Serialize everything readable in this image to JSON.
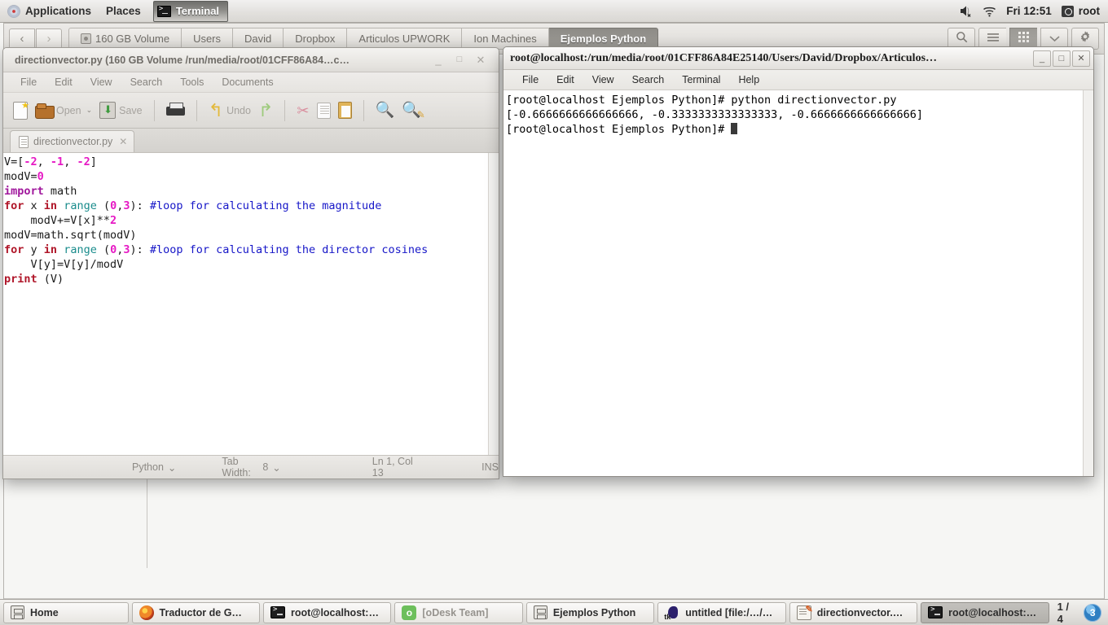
{
  "top_panel": {
    "applications_label": "Applications",
    "places_label": "Places",
    "active_task_label": "Terminal",
    "clock": "Fri 12:51",
    "user": "root",
    "icons": [
      "gnome-footprint-icon",
      "volume-muted-icon",
      "wifi-icon",
      "user-account-icon"
    ]
  },
  "file_manager": {
    "breadcrumbs": [
      {
        "label": "160 GB Volume",
        "active": false,
        "has_disk_icon": true
      },
      {
        "label": "Users",
        "active": false
      },
      {
        "label": "David",
        "active": false
      },
      {
        "label": "Dropbox",
        "active": false
      },
      {
        "label": "Articulos UPWORK",
        "active": false
      },
      {
        "label": "Ion Machines",
        "active": false
      },
      {
        "label": "Ejemplos Python",
        "active": true
      }
    ],
    "nav": {
      "back": "‹",
      "forward": "›"
    },
    "tools": [
      "search-icon",
      "list-view-icon",
      "grid-view-icon",
      "chevron-down-icon",
      "gear-icon"
    ]
  },
  "gedit": {
    "title": "directionvector.py (160 GB Volume /run/media/root/01CFF86A84…c…",
    "window_buttons": {
      "minimize": "_",
      "maximize": "□",
      "close": "✕"
    },
    "menus": [
      "File",
      "Edit",
      "View",
      "Search",
      "Tools",
      "Documents"
    ],
    "toolbar": {
      "open_label": "Open",
      "save_label": "Save",
      "undo_label": "Undo",
      "icons": [
        "new-document-icon",
        "open-folder-icon",
        "open-dropdown-caret-icon",
        "save-icon",
        "print-icon",
        "undo-icon",
        "redo-icon",
        "cut-icon",
        "copy-icon",
        "paste-icon",
        "find-icon",
        "find-replace-icon"
      ]
    },
    "tab": {
      "label": "directionvector.py",
      "close": "✕"
    },
    "code_lines": [
      "V=[-2, -1, -2]",
      "modV=0",
      "import math",
      "for x in range (0,3): #loop for calculating the magnitude",
      "    modV+=V[x]**2",
      "modV=math.sqrt(modV)",
      "for y in range (0,3): #loop for calculating the director cosines",
      "    V[y]=V[y]/modV",
      "print (V)"
    ],
    "statusbar": {
      "language": "Python",
      "language_caret": "⌄",
      "tab_width_label": "Tab Width:",
      "tab_width_value": "8",
      "tab_width_caret": "⌄",
      "position": "Ln 1, Col 13",
      "insert_mode": "INS"
    }
  },
  "terminal": {
    "title": "root@localhost:/run/media/root/01CFF86A84E25140/Users/David/Dropbox/Articulos…",
    "window_buttons": {
      "minimize": "_",
      "maximize": "□",
      "close": "✕"
    },
    "menus": [
      "File",
      "Edit",
      "View",
      "Search",
      "Terminal",
      "Help"
    ],
    "lines": [
      "[root@localhost Ejemplos Python]# python directionvector.py",
      "[-0.6666666666666666, -0.3333333333333333, -0.6666666666666666]",
      "[root@localhost Ejemplos Python]# "
    ]
  },
  "taskbar": {
    "buttons": [
      {
        "label": "Home",
        "icon": "file-manager-icon",
        "active": false,
        "dim": false
      },
      {
        "label": "Traductor de G…",
        "icon": "firefox-icon",
        "active": false,
        "dim": false
      },
      {
        "label": "root@localhost:…",
        "icon": "terminal-icon",
        "active": false,
        "dim": false
      },
      {
        "label": "[oDesk Team]",
        "icon": "odesk-icon",
        "active": false,
        "dim": true
      },
      {
        "label": "Ejemplos Python",
        "icon": "file-manager-icon",
        "active": false,
        "dim": false
      },
      {
        "label": "untitled [file:/…/…",
        "icon": "tk-icon",
        "active": false,
        "dim": false
      },
      {
        "label": "directionvector.…",
        "icon": "gedit-icon",
        "active": false,
        "dim": false
      },
      {
        "label": "root@localhost:…",
        "icon": "terminal-icon",
        "active": true,
        "dim": false
      }
    ],
    "workspace_counter": "1 / 4",
    "workspace_badge": "3"
  },
  "colors": {
    "panel_bg": "#e3e1de",
    "accent_blue": "#2f7fc2",
    "terminal_fg": "#000000",
    "code_keyword": "#b0172a",
    "code_number": "#e619c4",
    "code_comment": "#1616c8",
    "code_builtin": "#1a8c8c",
    "code_import": "#a0179c"
  }
}
